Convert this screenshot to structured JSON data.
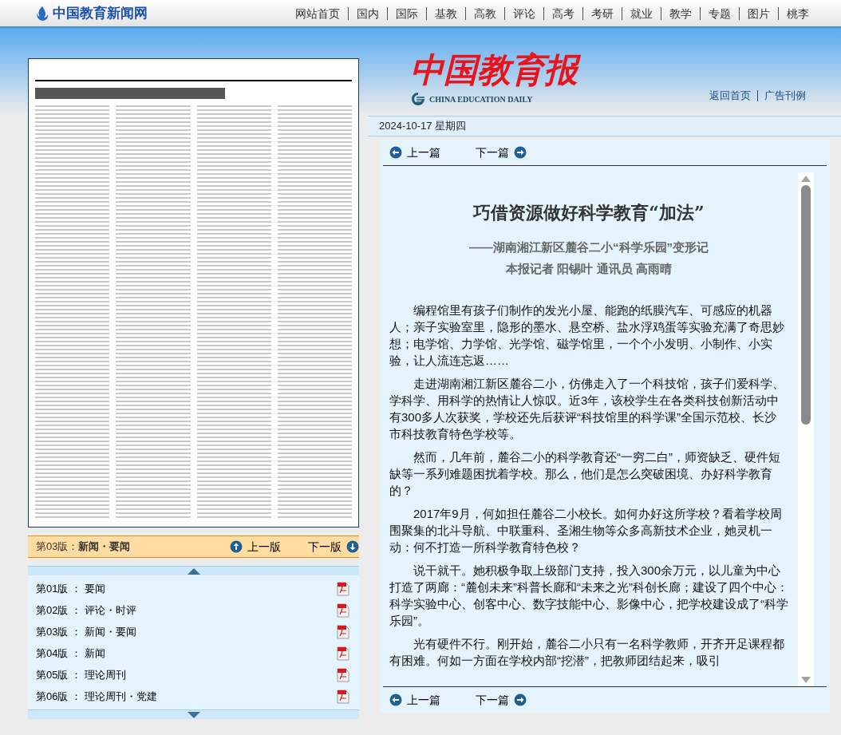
{
  "top_bar": {
    "site_name": "中国教育新闻网",
    "nav": [
      "网站首页",
      "国内",
      "国际",
      "基教",
      "高教",
      "评论",
      "高考",
      "考研",
      "就业",
      "教学",
      "专题",
      "图片",
      "桃李"
    ]
  },
  "header": {
    "masthead": "中国教育报",
    "masthead_en": "CHINA EDUCATION DAILY",
    "links": [
      "返回首页",
      "广告刊例"
    ]
  },
  "date": "2024-10-17 星期四",
  "edition_bar": {
    "current_label": "第03版：",
    "current_name": "新闻・要闻",
    "prev": "上一版",
    "next": "下一版"
  },
  "editions": [
    {
      "label": "第01版 ： 要闻"
    },
    {
      "label": "第02版 ： 评论・时评"
    },
    {
      "label": "第03版 ： 新闻・要闻"
    },
    {
      "label": "第04版 ： 新闻"
    },
    {
      "label": "第05版 ： 理论周刊"
    },
    {
      "label": "第06版 ： 理论周刊・党建"
    }
  ],
  "article_nav_top": {
    "prev": "上一篇",
    "next": "下一篇"
  },
  "article": {
    "title": "巧借资源做好科学教育“加法”",
    "subtitle": "——湖南湘江新区麓谷二小“科学乐园”变形记",
    "byline": "本报记者 阳锡叶 通讯员 高雨晴",
    "paragraphs": [
      "编程馆里有孩子们制作的发光小屋、能跑的纸膜汽车、可感应的机器人；亲子实验室里，隐形的墨水、悬空桥、盐水浮鸡蛋等实验充满了奇思妙想；电学馆、力学馆、光学馆、磁学馆里，一个个小发明、小制作、小实验，让人流连忘返……",
      "走进湖南湘江新区麓谷二小，仿佛走入了一个科技馆，孩子们爱科学、学科学、用科学的热情让人惊叹。近3年，该校学生在各类科技创新活动中有300多人次获奖，学校还先后获评“科技馆里的科学课”全国示范校、长沙市科技教育特色学校等。",
      "然而，几年前，麓谷二小的科学教育还“一穷二白”，师资缺乏、硬件短缺等一系列难题困扰着学校。那么，他们是怎么突破困境、办好科学教育的？",
      "2017年9月，何如担任麓谷二小校长。如何办好这所学校？看着学校周围聚集的北斗导航、中联重科、圣湘生物等众多高新技术企业，她灵机一动：何不打造一所科学教育特色校？",
      "说干就干。她积极争取上级部门支持，投入300余万元，以儿童为中心打造了两廊：“麓创未来”科普长廊和“未来之光”科创长廊；建设了四个中心：科学实验中心、创客中心、数字技能中心、影像中心，把学校建设成了“科学乐园”。",
      "光有硬件不行。刚开始，麓谷二小只有一名科学教师，开齐开足课程都有困难。何如一方面在学校内部“挖潜”，把教师团结起来，吸引"
    ]
  },
  "article_nav_bottom": {
    "prev": "上一篇",
    "next": "下一篇"
  }
}
